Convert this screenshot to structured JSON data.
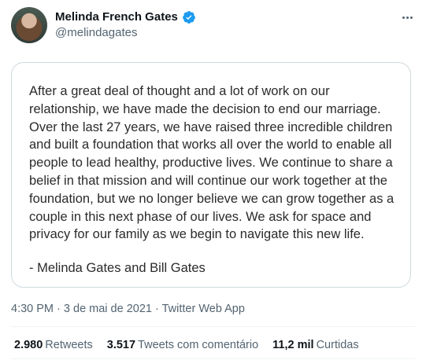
{
  "author": {
    "display_name": "Melinda French Gates",
    "handle": "@melindagates",
    "verified": true,
    "avatar_icon": "profile-photo"
  },
  "more_icon": "more-horizontal-icon",
  "statement": {
    "body": "After a great deal of thought and a lot of work on our relationship, we have made the decision to end our marriage. Over the last 27 years, we have raised three incredible children and built a foundation that works all over the world to enable all people to lead healthy, productive lives. We continue to share a belief in that mission and will continue our work together at the foundation, but we no longer believe we can grow together as a couple in this next phase of our lives. We ask for space and privacy for our family as we begin to navigate this new life.",
    "signature": "- Melinda Gates and Bill Gates"
  },
  "meta": {
    "time": "4:30 PM",
    "date": "3 de mai de 2021",
    "separator": "·",
    "source": "Twitter Web App"
  },
  "stats": [
    {
      "count": "2.980",
      "label": "Retweets"
    },
    {
      "count": "3.517",
      "label": "Tweets com comentário"
    },
    {
      "count": "11,2 mil",
      "label": "Curtidas"
    }
  ],
  "colors": {
    "verified_badge": "#1d9bf0",
    "secondary_text": "#536471",
    "border": "#cfd9de"
  }
}
